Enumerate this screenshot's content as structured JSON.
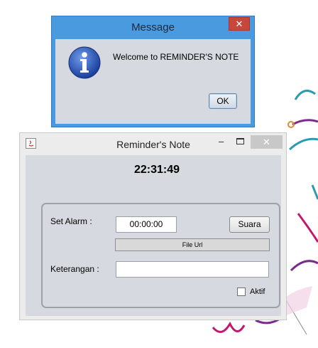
{
  "message_dialog": {
    "title": "Message",
    "close_glyph": "✕",
    "icon": "info-icon",
    "text": "Welcome to REMINDER'S NOTE",
    "ok_label": "OK"
  },
  "reminder_window": {
    "title": "Reminder's Note",
    "app_icon": "java-icon",
    "minimize_glyph": "–",
    "close_glyph": "✕",
    "clock": "22:31:49",
    "set_alarm_label": "Set Alarm :",
    "alarm_value": "00:00:00",
    "suara_label": "Suara",
    "file_url_label": "File Url",
    "keterangan_label": "Keterangan :",
    "keterangan_value": "",
    "aktif_label": "Aktif",
    "aktif_checked": false
  },
  "colors": {
    "dialog_frame": "#4a9ae0",
    "panel": "#d6d9df",
    "close_red": "#c7473a"
  }
}
